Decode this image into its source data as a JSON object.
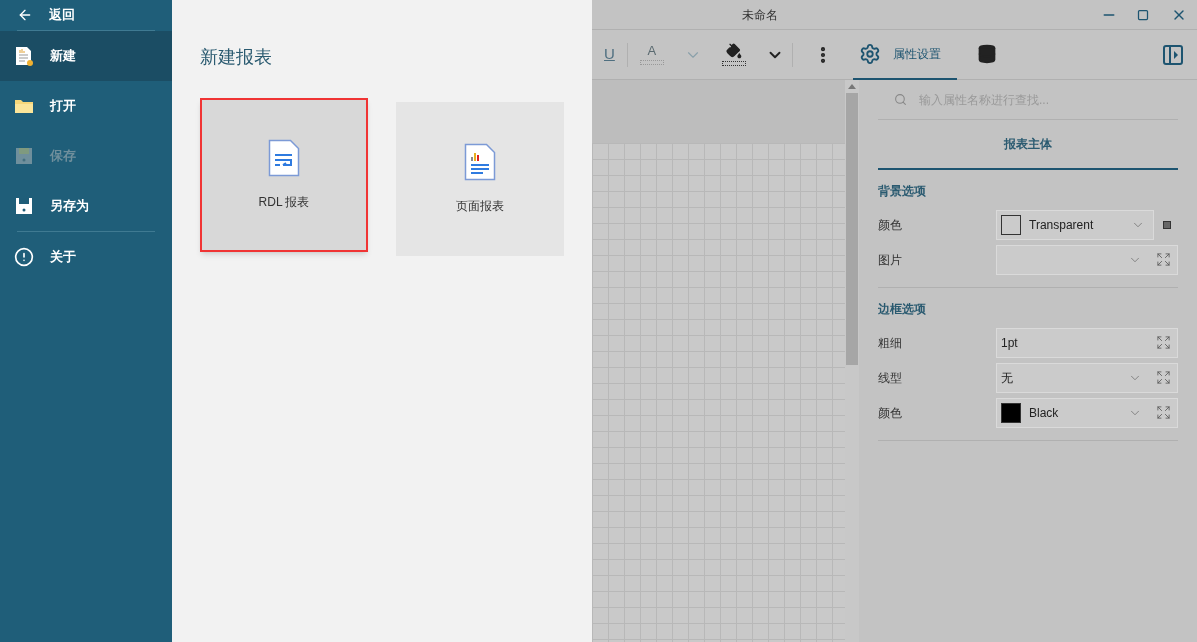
{
  "sidebar": {
    "back": "返回",
    "items": [
      {
        "label": "新建",
        "kind": "new",
        "selected": true,
        "disabled": false
      },
      {
        "label": "打开",
        "kind": "open",
        "selected": false,
        "disabled": false
      },
      {
        "label": "保存",
        "kind": "save",
        "selected": false,
        "disabled": true
      },
      {
        "label": "另存为",
        "kind": "saveas",
        "selected": false,
        "disabled": false
      }
    ],
    "footer_items": [
      {
        "label": "关于",
        "kind": "about",
        "selected": false,
        "disabled": false
      }
    ]
  },
  "panel": {
    "title": "新建报表",
    "cards": [
      {
        "label": "RDL 报表",
        "kind": "rdl",
        "selected": true
      },
      {
        "label": "页面报表",
        "kind": "page",
        "selected": false
      }
    ]
  },
  "window": {
    "title": "未命名"
  },
  "toolbar": {
    "buttons": [
      {
        "kind": "text",
        "label": "U",
        "disabled": true
      },
      {
        "kind": "font-color",
        "label": "A",
        "disabled": true
      },
      {
        "kind": "chevron",
        "disabled": true
      },
      {
        "kind": "fill",
        "disabled": false
      },
      {
        "kind": "chevron",
        "disabled": false
      },
      {
        "kind": "more",
        "disabled": false
      }
    ],
    "tabs": [
      {
        "label": "属性设置",
        "kind": "gear",
        "selected": true
      },
      {
        "kind": "database",
        "selected": false
      }
    ]
  },
  "properties": {
    "search": {
      "placeholder": "输入属性名称进行查找..."
    },
    "tab": "报表主体",
    "sections": [
      {
        "title": "背景选项",
        "rows": [
          {
            "label": "颜色",
            "kind": "color",
            "value": "Transparent",
            "dropdown": true,
            "expand": false,
            "color_picker": true
          },
          {
            "label": "图片",
            "kind": "select",
            "dropdown": true,
            "expand": true,
            "color_picker": false
          }
        ]
      },
      {
        "title": "边框选项",
        "rows": [
          {
            "label": "粗细",
            "kind": "text",
            "value": "1pt",
            "dropdown": false,
            "expand": true,
            "color_picker": false
          },
          {
            "label": "线型",
            "kind": "select",
            "value": "无",
            "dropdown": true,
            "expand": true,
            "color_picker": false
          },
          {
            "label": "颜色",
            "kind": "color",
            "value": "Black",
            "color": "#000000",
            "dropdown": true,
            "expand": true,
            "color_picker": false
          }
        ]
      }
    ]
  }
}
